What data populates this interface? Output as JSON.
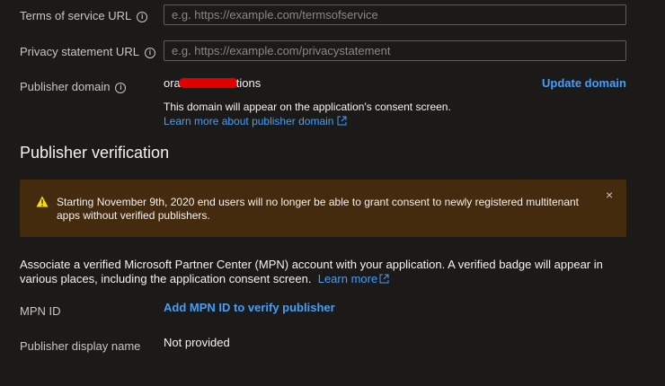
{
  "fields": {
    "terms": {
      "label": "Terms of service URL",
      "placeholder": "e.g. https://example.com/termsofservice"
    },
    "privacy": {
      "label": "Privacy statement URL",
      "placeholder": "e.g. https://example.com/privacystatement"
    },
    "publisher_domain": {
      "label": "Publisher domain",
      "value_start": "ora",
      "value_end": "tions",
      "update_label": "Update domain",
      "note": "This domain will appear on the application's consent screen.",
      "learn_more": "Learn more about publisher domain"
    }
  },
  "verification": {
    "title": "Publisher verification",
    "warning": "Starting November 9th, 2020 end users will no longer be able to grant consent to newly registered multitenant apps without verified publishers.",
    "close_symbol": "×",
    "description": "Associate a verified Microsoft Partner Center (MPN) account with your application. A verified badge will appear in various places, including the application consent screen.",
    "learn_more": "Learn more",
    "mpn_label": "MPN ID",
    "mpn_action": "Add MPN ID to verify publisher",
    "display_name_label": "Publisher display name",
    "display_name_value": "Not provided"
  },
  "colors": {
    "background": "#1b1a19",
    "link": "#479ef5",
    "warning_bg": "#442b0d",
    "warning_icon": "#fce100",
    "redaction": "#e00000"
  },
  "icons": [
    "info-icon",
    "external-link-icon",
    "warning-icon",
    "close-icon"
  ]
}
